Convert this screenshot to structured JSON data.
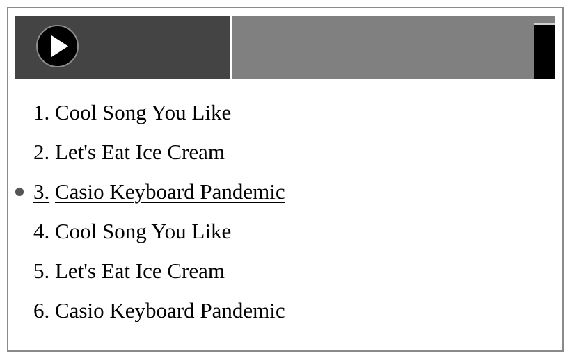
{
  "player": {
    "play_icon": "play-icon",
    "colors": {
      "controls_bg": "#444444",
      "track_area_bg": "#808080",
      "play_button_bg": "#000000",
      "play_button_border": "#8c8c8c"
    }
  },
  "playlist": {
    "current_index": 2,
    "tracks": [
      {
        "number": "1.",
        "title": "Cool Song You Like"
      },
      {
        "number": "2.",
        "title": "Let's Eat Ice Cream"
      },
      {
        "number": "3.",
        "title": "Casio Keyboard Pandemic"
      },
      {
        "number": "4.",
        "title": "Cool Song You Like"
      },
      {
        "number": "5.",
        "title": "Let's Eat Ice Cream"
      },
      {
        "number": "6.",
        "title": "Casio Keyboard Pandemic"
      }
    ]
  }
}
